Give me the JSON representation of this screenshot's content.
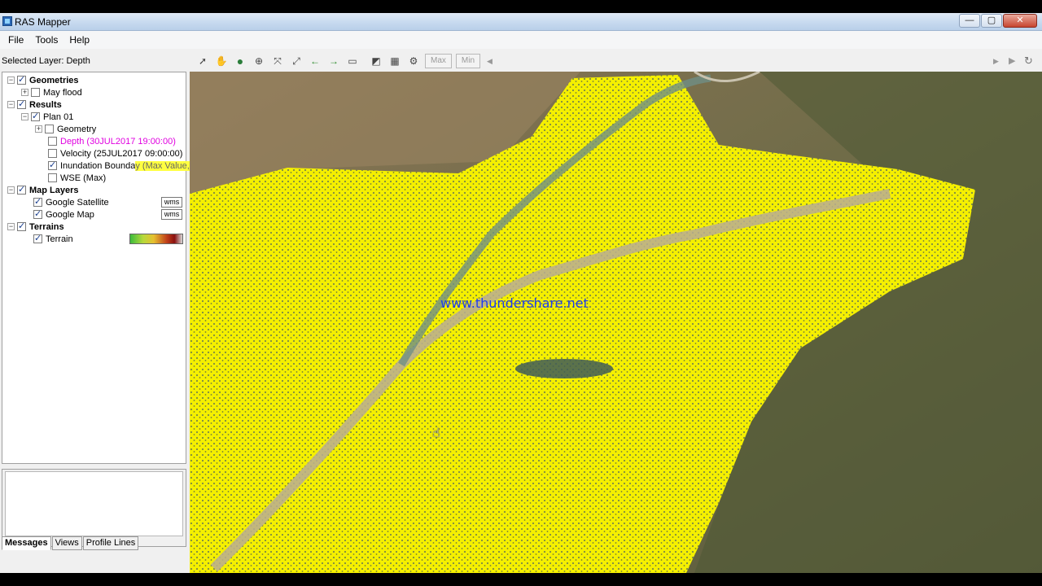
{
  "window": {
    "title": "RAS Mapper",
    "buttons": {
      "minimize": "—",
      "maximize": "▢",
      "close": "✕"
    }
  },
  "menu": {
    "items": [
      "File",
      "Tools",
      "Help"
    ]
  },
  "toolbar": {
    "selected_layer": "Selected Layer: Depth",
    "max_label": "Max",
    "min_label": "Min",
    "icons": [
      "select-pointer-icon",
      "pan-hand-icon",
      "globe-icon",
      "zoom-in-icon",
      "zoom-out-icon",
      "full-extent-icon",
      "back-arrow-icon",
      "forward-arrow-icon",
      "measure-ruler-icon",
      "profile-icon",
      "grid-icon",
      "gear-icon"
    ]
  },
  "tree": {
    "geometries": {
      "label": "Geometries",
      "checked": true
    },
    "may_flood": {
      "label": "May flood",
      "checked": false
    },
    "results": {
      "label": "Results",
      "checked": true
    },
    "plan01": {
      "label": "Plan 01",
      "checked": true
    },
    "geometry": {
      "label": "Geometry",
      "checked": false
    },
    "depth": {
      "label": "Depth (30JUL2017 19:00:00)",
      "checked": false,
      "color": "#e000e0"
    },
    "velocity": {
      "label": "Velocity (25JUL2017 09:00:00)",
      "checked": false
    },
    "inundation": {
      "label": "Inundation Bounda",
      "suffix": "y (Max Value,",
      "checked": true
    },
    "wse": {
      "label": "WSE (Max)",
      "checked": false
    },
    "map_layers": {
      "label": "Map Layers",
      "checked": true
    },
    "google_satellite": {
      "label": "Google Satellite",
      "checked": true,
      "badge": "wms"
    },
    "google_map": {
      "label": "Google Map",
      "checked": true,
      "badge": "wms"
    },
    "terrains": {
      "label": "Terrains",
      "checked": true
    },
    "terrain": {
      "label": "Terrain",
      "checked": true
    }
  },
  "bottom_tabs": [
    "Messages",
    "Views",
    "Profile Lines"
  ],
  "map": {
    "watermark": "www.thundershare.net",
    "overlay_color": "#f5f000"
  }
}
